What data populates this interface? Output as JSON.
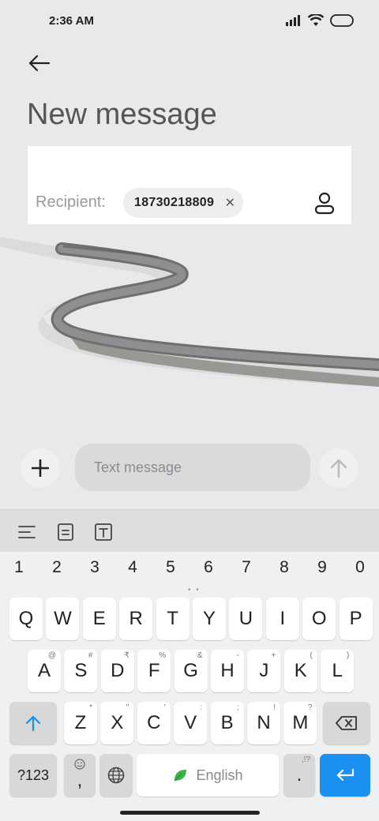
{
  "status_bar": {
    "time": "2:36 AM"
  },
  "header": {
    "title": "New message"
  },
  "recipient": {
    "label": "Recipient:",
    "chip_value": "18730218809",
    "chip_close": "✕"
  },
  "composer": {
    "placeholder": "Text message"
  },
  "keyboard": {
    "numbers": [
      "1",
      "2",
      "3",
      "4",
      "5",
      "6",
      "7",
      "8",
      "9",
      "0"
    ],
    "row1": [
      "Q",
      "W",
      "E",
      "R",
      "T",
      "Y",
      "U",
      "I",
      "O",
      "P"
    ],
    "row2": [
      {
        "k": "A",
        "s": "@"
      },
      {
        "k": "S",
        "s": "#"
      },
      {
        "k": "D",
        "s": "₹"
      },
      {
        "k": "F",
        "s": "%"
      },
      {
        "k": "G",
        "s": "&"
      },
      {
        "k": "H",
        "s": "-"
      },
      {
        "k": "J",
        "s": "+"
      },
      {
        "k": "K",
        "s": "("
      },
      {
        "k": "L",
        "s": ")"
      }
    ],
    "row3": [
      {
        "k": "Z",
        "s": "*"
      },
      {
        "k": "X",
        "s": "\""
      },
      {
        "k": "C",
        "s": "'"
      },
      {
        "k": "V",
        "s": ":"
      },
      {
        "k": "B",
        "s": ";"
      },
      {
        "k": "N",
        "s": "!"
      },
      {
        "k": "M",
        "s": "?"
      }
    ],
    "symbols_label": "?123",
    "comma": ",",
    "space_label": "English",
    "period": ".",
    "period_sup": ",!?"
  }
}
